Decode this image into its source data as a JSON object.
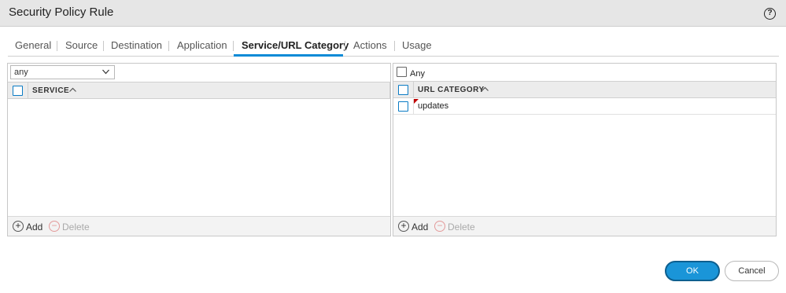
{
  "dialog": {
    "title": "Security Policy Rule",
    "help_label": "?"
  },
  "tabs": [
    {
      "label": "General"
    },
    {
      "label": "Source"
    },
    {
      "label": "Destination"
    },
    {
      "label": "Application"
    },
    {
      "label": "Service/URL Category",
      "active": true
    },
    {
      "label": "Actions"
    },
    {
      "label": "Usage"
    }
  ],
  "service_panel": {
    "select_value": "any",
    "column_header": "SERVICE",
    "rows": [],
    "add_label": "Add",
    "delete_label": "Delete"
  },
  "url_panel": {
    "any_label": "Any",
    "any_checked": false,
    "column_header": "URL CATEGORY",
    "rows": [
      {
        "name": "updates"
      }
    ],
    "add_label": "Add",
    "delete_label": "Delete"
  },
  "buttons": {
    "ok": "OK",
    "cancel": "Cancel"
  },
  "colors": {
    "accent": "#0a8ad6",
    "ok_fill": "#1a95d8",
    "header_bg": "#ececec"
  },
  "icons": {
    "help": "question-circle-icon",
    "sort": "sort-asc-icon",
    "add": "plus-circle-icon",
    "delete": "minus-circle-icon",
    "dropdown": "chevron-down-icon"
  }
}
